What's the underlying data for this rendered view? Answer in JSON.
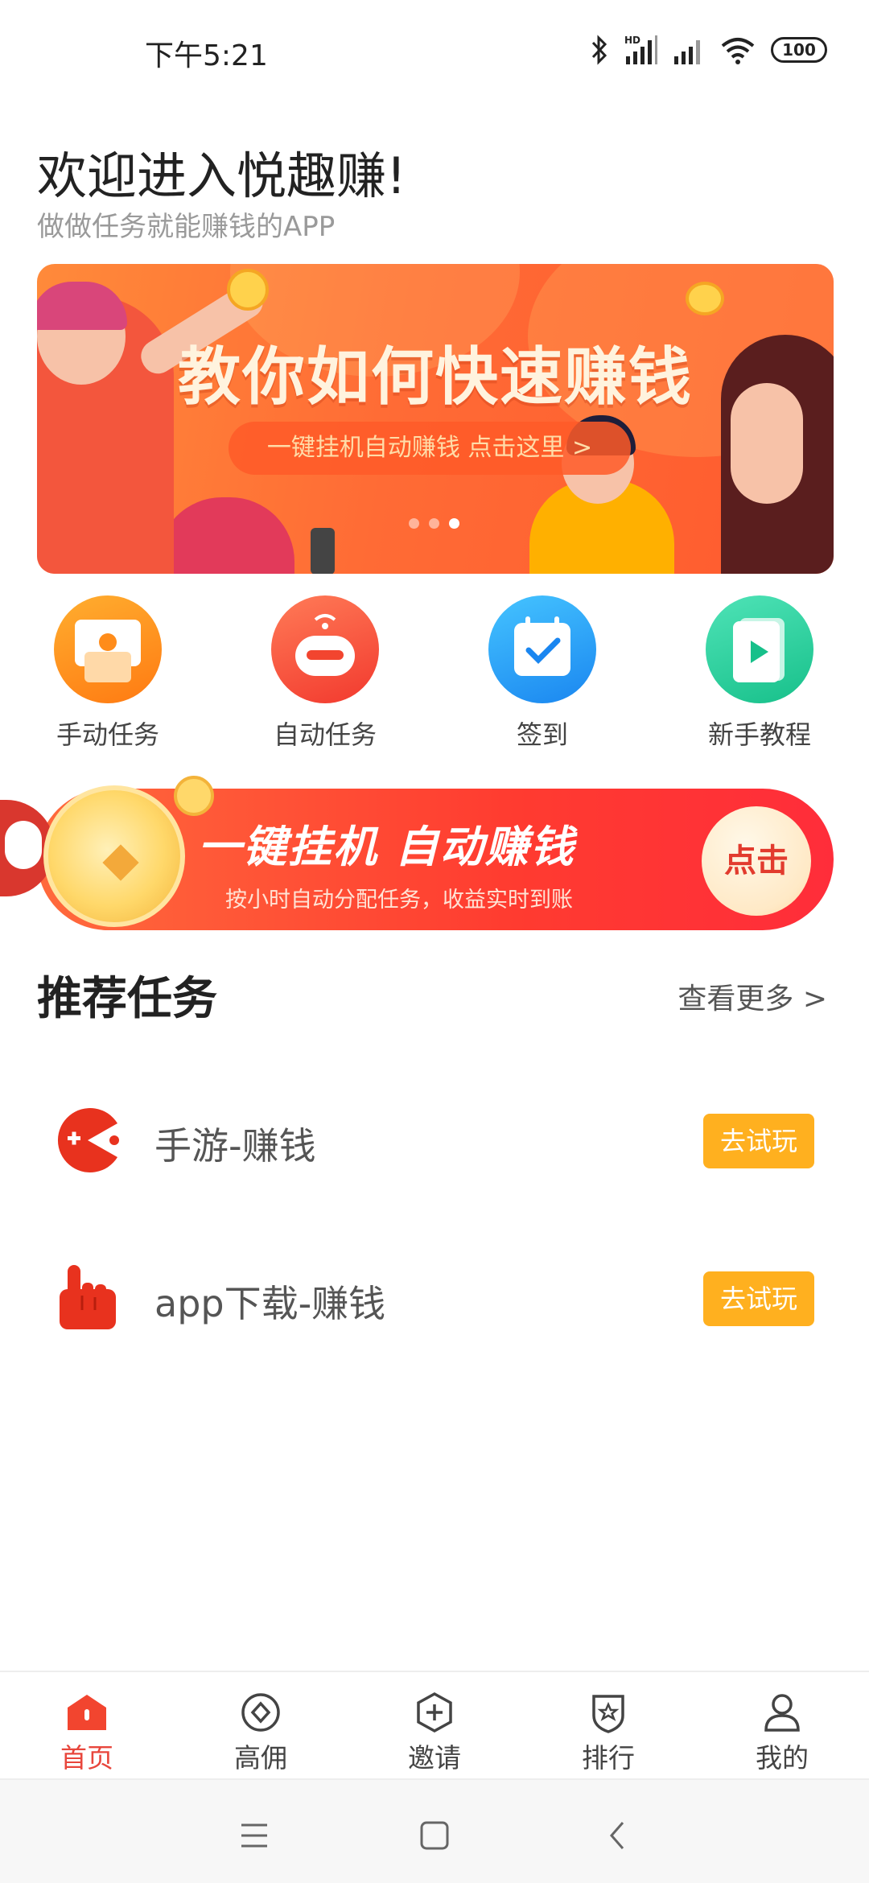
{
  "status_bar": {
    "time": "下午5:21",
    "hd_badge": "HD",
    "battery": "100"
  },
  "header": {
    "title": "欢迎进入悦趣赚!",
    "subtitle": "做做任务就能赚钱的APP"
  },
  "banner": {
    "title": "教你如何快速赚钱",
    "pill_text": "一键挂机自动赚钱    点击这里 >",
    "page_count": 3,
    "active_page": 3,
    "colors": {
      "start": "#ff8a3a",
      "end": "#ff5a2e"
    }
  },
  "quick_actions": [
    {
      "label": "手动任务",
      "icon": "manual-task-icon",
      "color": "#ff8c1a"
    },
    {
      "label": "自动任务",
      "icon": "robot-icon",
      "color": "#f2452f"
    },
    {
      "label": "签到",
      "icon": "calendar-check-icon",
      "color": "#1a9bf5"
    },
    {
      "label": "新手教程",
      "icon": "video-play-icon",
      "color": "#1fcb95"
    }
  ],
  "promo": {
    "title": "一键挂机 自动赚钱",
    "subtitle": "按小时自动分配任务，收益实时到账",
    "button_label": "点击"
  },
  "recommended": {
    "title": "推荐任务",
    "more_label": "查看更多 >",
    "tasks": [
      {
        "label": "手游-赚钱",
        "icon": "game-pacman-icon",
        "button": "去试玩"
      },
      {
        "label": "app下载-赚钱",
        "icon": "pointing-hand-icon",
        "button": "去试玩"
      }
    ]
  },
  "tab_bar": {
    "active": "首页",
    "accent": "#e8463c",
    "tabs": [
      {
        "label": "首页",
        "icon": "home-icon"
      },
      {
        "label": "高佣",
        "icon": "diamond-circle-icon"
      },
      {
        "label": "邀请",
        "icon": "invite-plus-icon"
      },
      {
        "label": "排行",
        "icon": "ranking-shield-icon"
      },
      {
        "label": "我的",
        "icon": "user-icon"
      }
    ]
  },
  "system_nav": {
    "buttons": [
      "menu-icon",
      "home-square-icon",
      "back-icon"
    ]
  }
}
